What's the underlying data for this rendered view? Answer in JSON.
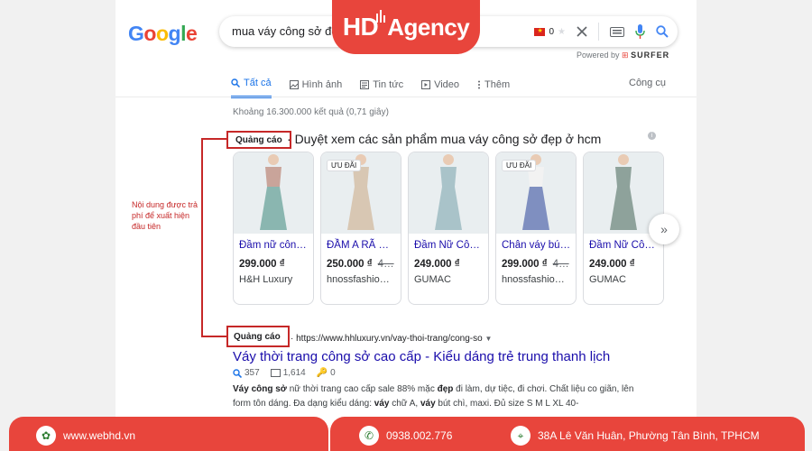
{
  "brand": {
    "prefix": "HD",
    "name": "Agency"
  },
  "google": {
    "logo_letters": [
      {
        "ch": "G",
        "color": "#4285F4"
      },
      {
        "ch": "o",
        "color": "#EA4335"
      },
      {
        "ch": "o",
        "color": "#FBBC05"
      },
      {
        "ch": "g",
        "color": "#4285F4"
      },
      {
        "ch": "l",
        "color": "#34A853"
      },
      {
        "ch": "e",
        "color": "#EA4335"
      }
    ],
    "query": "mua váy công sở đẹp",
    "flag_count": "0",
    "powered_by": "Powered by",
    "surfer": "SURFER"
  },
  "tabs": [
    {
      "label": "Tất cả",
      "icon": "search-icon",
      "active": true
    },
    {
      "label": "Hình ảnh",
      "icon": "image-icon"
    },
    {
      "label": "Tin tức",
      "icon": "news-icon"
    },
    {
      "label": "Video",
      "icon": "video-icon"
    },
    {
      "label": "Thêm",
      "icon": "more-icon"
    }
  ],
  "tools_label": "Công cụ",
  "result_stats": "Khoảng 16.300.000 kết quả (0,71 giây)",
  "shopping_ad": {
    "label": "Quảng cáo",
    "title": "Duyệt xem các sản phẩm mua váy công sở đẹp ở hcm",
    "info_icon": "i",
    "products": [
      {
        "title": "Đầm nữ côn…",
        "price": "299.000 ₫",
        "old_price": "",
        "merchant": "H&H Luxury",
        "badge": "",
        "dress_color": "#8ab6b0",
        "top_color": "#c9a49a"
      },
      {
        "title": "ĐẦM A RÃ …",
        "price": "250.000 ₫",
        "old_price": "4…",
        "merchant": "hnossfashio…",
        "badge": "ƯU ĐÃI",
        "dress_color": "#d8c7b3",
        "top_color": "#d8c7b3"
      },
      {
        "title": "Đầm Nữ Cô…",
        "price": "249.000 ₫",
        "old_price": "",
        "merchant": "GUMAC",
        "badge": "",
        "dress_color": "#a9c3c9",
        "top_color": "#a9c3c9"
      },
      {
        "title": "Chân váy bú…",
        "price": "299.000 ₫",
        "old_price": "4…",
        "merchant": "hnossfashio…",
        "badge": "ƯU ĐÃI",
        "dress_color": "#7f8fc0",
        "top_color": "#f2f2f2"
      },
      {
        "title": "Đầm Nữ Cô…",
        "price": "249.000 ₫",
        "old_price": "",
        "merchant": "GUMAC",
        "badge": "",
        "dress_color": "#8ea29b",
        "top_color": "#8ea29b"
      }
    ],
    "next_label": "»"
  },
  "annotation_note": "Nội dung được trả phí để xuất hiện đầu tiên",
  "text_ad": {
    "label": "Quảng cáo",
    "url": "https://www.hhluxury.vn/vay-thoi-trang/cong-so",
    "title": "Váy thời trang công sở cao cấp - Kiểu dáng trẻ trung thanh lịch",
    "stat_views": "357",
    "stat_comments": "1,614",
    "stat_keys": "0",
    "desc_parts": [
      {
        "t": "Váy công sở",
        "b": true
      },
      {
        "t": " nữ thời trang cao cấp sale 88% mặc ",
        "b": false
      },
      {
        "t": "đẹp",
        "b": true
      },
      {
        "t": " đi làm, dự tiệc, đi chơi. Chất liệu co giãn, lên form tôn dáng. Đa dạng kiểu dáng: ",
        "b": false
      },
      {
        "t": "váy",
        "b": true
      },
      {
        "t": " chữ A, ",
        "b": false
      },
      {
        "t": "váy",
        "b": true
      },
      {
        "t": " bút chì, maxi. Đủ size S M L XL 40-",
        "b": false
      }
    ]
  },
  "footer": {
    "website": "www.webhd.vn",
    "phone": "0938.002.776",
    "address": "38A Lê Văn Huân, Phường Tân Bình, TPHCM"
  },
  "colors": {
    "accent_red": "#e8453c",
    "annotation_red": "#c62828",
    "link_blue": "#1a0dab",
    "tab_blue": "#1a73e8"
  }
}
